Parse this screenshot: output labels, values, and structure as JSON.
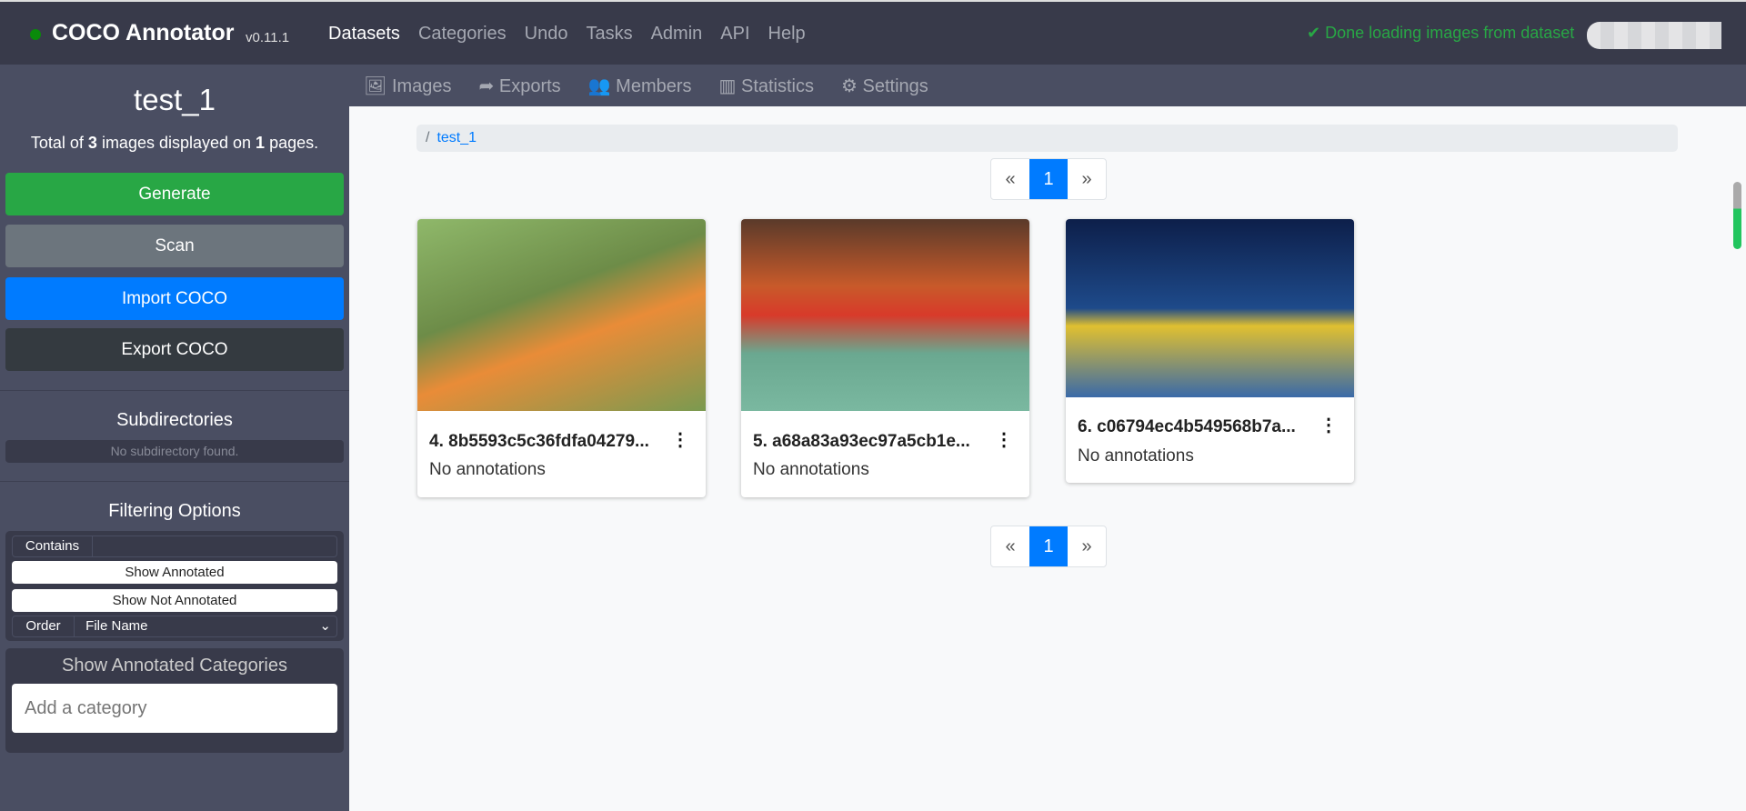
{
  "app": {
    "title": "COCO Annotator",
    "version": "v0.11.1",
    "status": "Done loading images from dataset"
  },
  "nav": [
    "Datasets",
    "Categories",
    "Undo",
    "Tasks",
    "Admin",
    "API",
    "Help"
  ],
  "tabs": [
    "Images",
    "Exports",
    "Members",
    "Statistics",
    "Settings"
  ],
  "sidebar": {
    "title": "test_1",
    "total_pre": "Total of ",
    "count": "3",
    "total_mid": " images displayed on ",
    "pages": "1",
    "total_post": " pages.",
    "generate": "Generate",
    "scan": "Scan",
    "import": "Import COCO",
    "export": "Export COCO",
    "subdirectories": "Subdirectories",
    "no_sub": "No subdirectory found.",
    "filtering": "Filtering Options",
    "contains": "Contains",
    "show_annotated": "Show Annotated",
    "show_not_annotated": "Show Not Annotated",
    "order": "Order",
    "order_value": "File Name",
    "categories_title": "Show Annotated Categories",
    "category_placeholder": "Add a category"
  },
  "breadcrumb": {
    "sep": "/",
    "item": "test_1"
  },
  "pagination": {
    "prev": "«",
    "current": "1",
    "next": "»"
  },
  "images": [
    {
      "name": "4. 8b5593c5c36fdfa04279...",
      "annotations": "No annotations"
    },
    {
      "name": "5. a68a83a93ec97a5cb1e...",
      "annotations": "No annotations"
    },
    {
      "name": "6. c06794ec4b549568b7a...",
      "annotations": "No annotations"
    }
  ],
  "colors": {
    "navbar": "#383a4a",
    "sidebar": "#4a4e62",
    "success": "#28a745",
    "primary": "#007bff",
    "secondary": "#6c757d",
    "dark": "#343a40"
  }
}
